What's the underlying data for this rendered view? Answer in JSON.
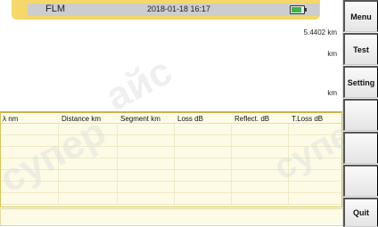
{
  "status_bar": {
    "model": "FLM",
    "datetime": "2018-01-18 16:17",
    "battery_level_percent": 85,
    "battery_color": "#39b54a",
    "background_color": "#f4d86a"
  },
  "display": {
    "readouts": [
      "5.4402 km",
      "km",
      "km"
    ]
  },
  "event_table": {
    "columns": [
      "λ nm",
      "Distance km",
      "Segment km",
      "Loss dB",
      "Reflect. dB",
      "T.Loss dB"
    ],
    "rows": [
      [
        "",
        "",
        "",
        "",
        "",
        ""
      ],
      [
        "",
        "",
        "",
        "",
        "",
        ""
      ],
      [
        "",
        "",
        "",
        "",
        "",
        ""
      ],
      [
        "",
        "",
        "",
        "",
        "",
        ""
      ],
      [
        "",
        "",
        "",
        "",
        "",
        ""
      ],
      [
        "",
        "",
        "",
        "",
        "",
        ""
      ],
      [
        "",
        "",
        "",
        "",
        "",
        ""
      ],
      [
        "",
        "",
        "",
        "",
        "",
        ""
      ]
    ]
  },
  "side_menu": {
    "buttons": [
      "Menu",
      "Test",
      "Setting",
      "",
      "",
      "",
      "Quit"
    ]
  },
  "watermark": {
    "text": "супер айс"
  }
}
